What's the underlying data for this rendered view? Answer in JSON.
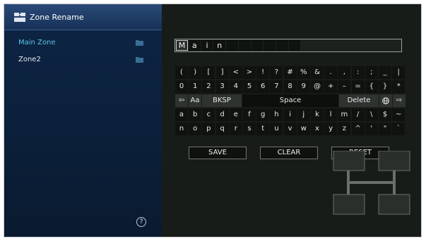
{
  "header": {
    "title": "Zone Rename"
  },
  "zones": [
    {
      "label": "Main Zone",
      "selected": true
    },
    {
      "label": "Zone2",
      "selected": false
    }
  ],
  "help": {
    "label": "?"
  },
  "name_input": {
    "characters": [
      "M",
      "a",
      "i",
      "n",
      "",
      "",
      "",
      "",
      "",
      ""
    ]
  },
  "keyboard": {
    "row1": [
      "(",
      ")",
      "[",
      "]",
      "<",
      ">",
      "!",
      "?",
      "#",
      "%",
      "&",
      ".",
      ",",
      ":",
      ";",
      "_",
      "|"
    ],
    "row2": [
      "0",
      "1",
      "2",
      "3",
      "4",
      "5",
      "6",
      "7",
      "8",
      "9",
      "@",
      "+",
      "–",
      "=",
      "{",
      "}",
      "*"
    ],
    "row3": {
      "left_arrow": "⇦",
      "case": "Aa",
      "backspace": "BKSP",
      "space": "Space",
      "delete": "Delete",
      "globe": "🌐",
      "right_arrow": "⇨"
    },
    "row4": [
      "a",
      "b",
      "c",
      "d",
      "e",
      "f",
      "g",
      "h",
      "i",
      "j",
      "k",
      "l",
      "m",
      "/",
      "\\",
      "$",
      "~"
    ],
    "row5": [
      "n",
      "o",
      "p",
      "q",
      "r",
      "s",
      "t",
      "u",
      "v",
      "w",
      "x",
      "y",
      "z",
      "^",
      "'",
      "\"",
      "`"
    ]
  },
  "actions": {
    "save": "SAVE",
    "clear": "CLEAR",
    "reset": "RESET"
  },
  "colors": {
    "sidebar": "#0b2040",
    "selected_zone": "#5fc3e8",
    "background": "#181c19"
  }
}
